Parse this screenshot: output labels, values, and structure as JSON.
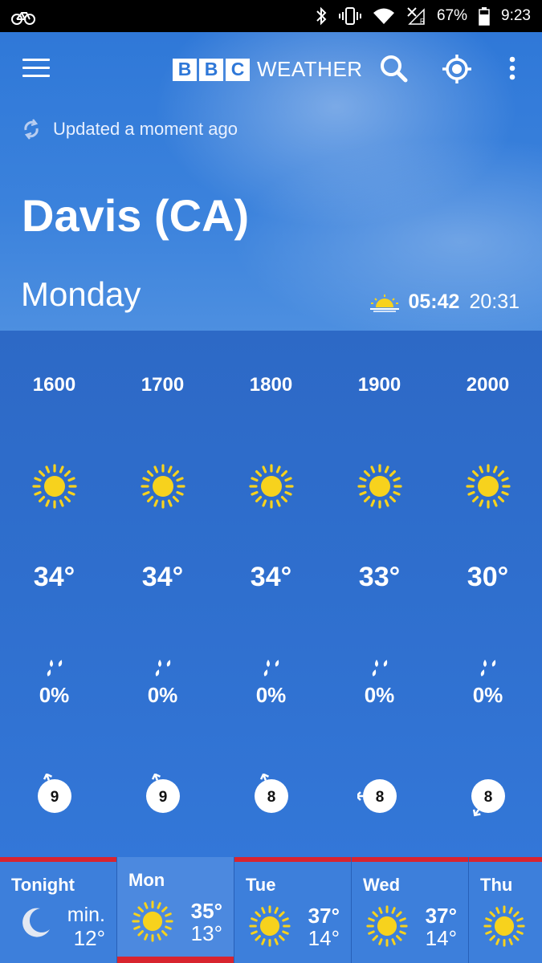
{
  "status_bar": {
    "battery": "67%",
    "time": "9:23"
  },
  "header": {
    "logo_letters": [
      "B",
      "B",
      "C"
    ],
    "logo_word": "WEATHER",
    "updated_text": "Updated a moment ago",
    "city": "Davis (CA)",
    "day": "Monday",
    "sunrise": "05:42",
    "sunset": "20:31"
  },
  "hourly": [
    {
      "time": "1600",
      "icon": "sun-icon",
      "temp": "34°",
      "rain": "0%",
      "wind_speed": "9",
      "wind_dir": "south-southeast"
    },
    {
      "time": "1700",
      "icon": "sun-icon",
      "temp": "34°",
      "rain": "0%",
      "wind_speed": "9",
      "wind_dir": "south-southeast"
    },
    {
      "time": "1800",
      "icon": "sun-icon",
      "temp": "34°",
      "rain": "0%",
      "wind_speed": "8",
      "wind_dir": "south-southeast"
    },
    {
      "time": "1900",
      "icon": "sun-icon",
      "temp": "33°",
      "rain": "0%",
      "wind_speed": "8",
      "wind_dir": "east"
    },
    {
      "time": "2000",
      "icon": "sun-icon",
      "temp": "30°",
      "rain": "0%",
      "wind_speed": "8",
      "wind_dir": "northeast"
    }
  ],
  "daily": [
    {
      "name": "Tonight",
      "icon": "moon-icon",
      "min_label": "min.",
      "lo": "12°"
    },
    {
      "name": "Mon",
      "icon": "sun-icon",
      "hi": "35°",
      "lo": "13°",
      "selected": true
    },
    {
      "name": "Tue",
      "icon": "sun-icon",
      "hi": "37°",
      "lo": "14°"
    },
    {
      "name": "Wed",
      "icon": "sun-icon",
      "hi": "37°",
      "lo": "14°"
    },
    {
      "name": "Thu",
      "icon": "sun-icon"
    }
  ],
  "colors": {
    "accent_red": "#d8242f",
    "sun_yellow": "#f7d21d",
    "sky_blue": "#2f6fcf"
  }
}
